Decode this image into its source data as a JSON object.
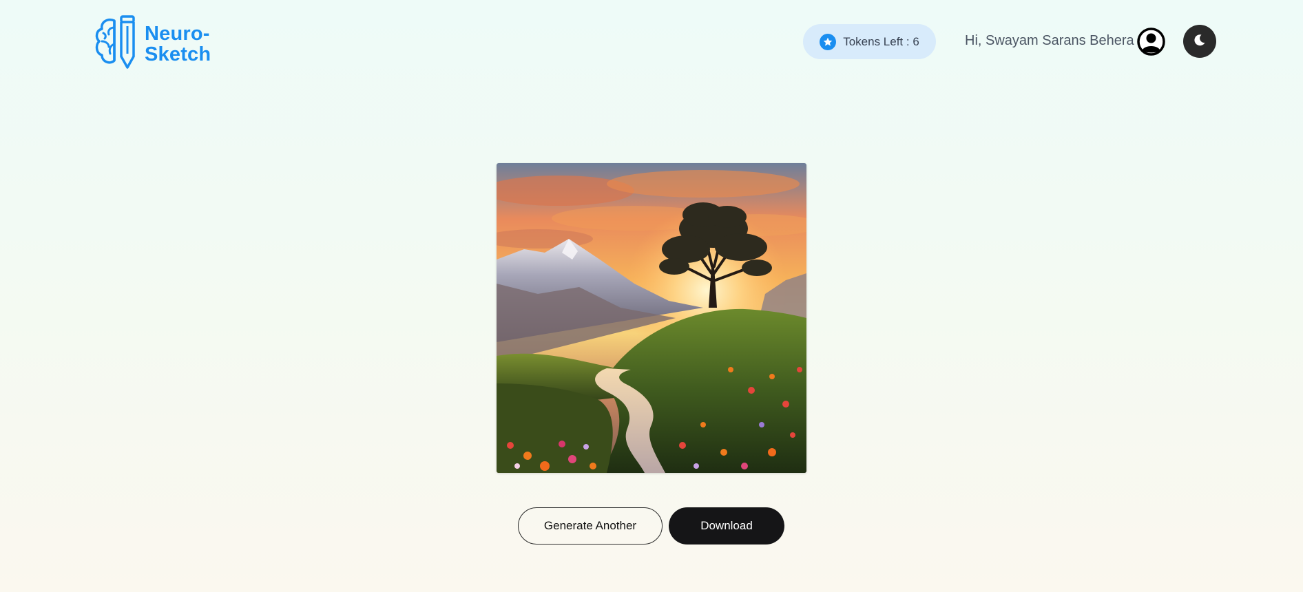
{
  "brand": {
    "name_line1": "Neuro-",
    "name_line2": "Sketch",
    "logo_icon": "brain-pencil-icon",
    "color": "#1a8ef0"
  },
  "header": {
    "tokens_label": "Tokens Left : 6",
    "tokens_icon": "star-icon",
    "greeting": "Hi, Swayam Sarans Behera",
    "avatar_icon": "user-circle-icon",
    "theme_toggle_icon": "moon-icon"
  },
  "main": {
    "image_icon": "generated-landscape-image"
  },
  "actions": {
    "generate_label": "Generate Another",
    "download_label": "Download"
  },
  "colors": {
    "accent": "#1a8ef0",
    "pill_bg": "#d8ebfb",
    "dark_button": "#151517",
    "toggle_bg": "#2a2a2a"
  }
}
